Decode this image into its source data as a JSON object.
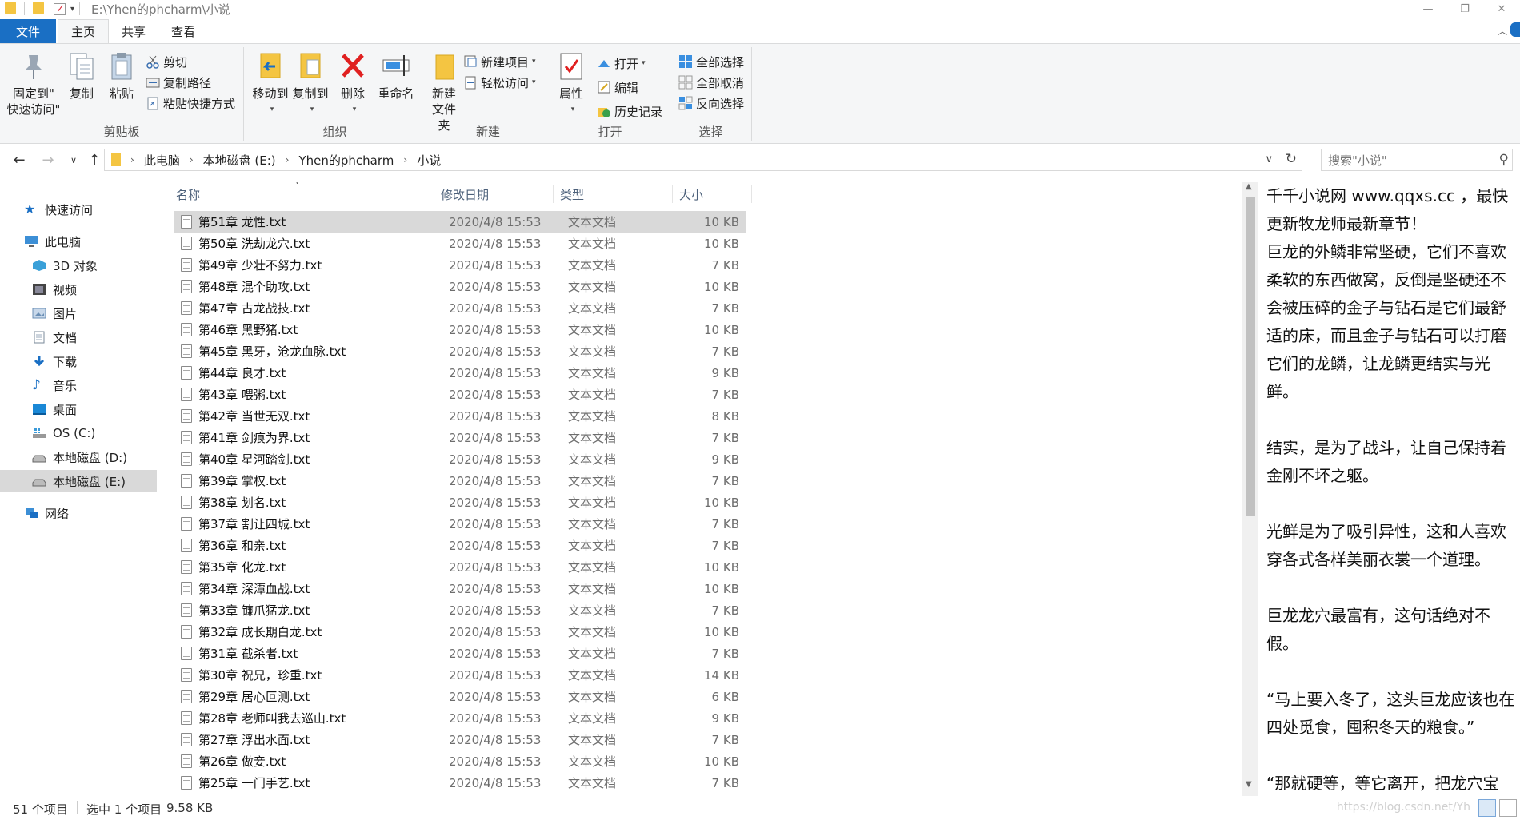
{
  "window": {
    "title": "E:\\Yhen的phcharm\\小说",
    "minimize": "—",
    "restore": "❐",
    "close": "✕"
  },
  "tabs": [
    {
      "label": "文件"
    },
    {
      "label": "主页"
    },
    {
      "label": "共享"
    },
    {
      "label": "查看"
    }
  ],
  "ribbon": {
    "clipboard": {
      "label": "剪贴板",
      "pin": "固定到\"\n快速访问\"",
      "pin1": "固定到\"",
      "pin2": "快速访问\"",
      "copy": "复制",
      "paste": "粘贴",
      "cut": "剪切",
      "copy_path": "复制路径",
      "paste_shortcut": "粘贴快捷方式"
    },
    "organize": {
      "label": "组织",
      "move_to": "移动到",
      "copy_to": "复制到",
      "delete": "删除",
      "rename": "重命名"
    },
    "new": {
      "label": "新建",
      "new_folder1": "新建",
      "new_folder2": "文件夹",
      "new_item": "新建项目",
      "easy_access": "轻松访问"
    },
    "open": {
      "label": "打开",
      "properties": "属性",
      "open": "打开",
      "edit": "编辑",
      "history": "历史记录"
    },
    "select": {
      "label": "选择",
      "select_all": "全部选择",
      "select_none": "全部取消",
      "invert": "反向选择"
    }
  },
  "address": {
    "crumbs": [
      "此电脑",
      "本地磁盘 (E:)",
      "Yhen的phcharm",
      "小说"
    ],
    "search_placeholder": "搜索\"小说\""
  },
  "nav": [
    {
      "label": "快速访问",
      "icon": "star-icon",
      "color": "#1a6fc4"
    },
    {
      "label": "此电脑",
      "icon": "computer-icon",
      "color": "#3c8fd6"
    },
    {
      "label": "3D 对象",
      "icon": "cube-icon",
      "color": "#3aa0d8"
    },
    {
      "label": "视频",
      "icon": "video-icon",
      "color": "#5b5b5b"
    },
    {
      "label": "图片",
      "icon": "picture-icon",
      "color": "#6b8fb5"
    },
    {
      "label": "文档",
      "icon": "document-icon",
      "color": "#7a8a9a"
    },
    {
      "label": "下载",
      "icon": "download-icon",
      "color": "#1a6fc4"
    },
    {
      "label": "音乐",
      "icon": "music-icon",
      "color": "#1a6fc4"
    },
    {
      "label": "桌面",
      "icon": "desktop-icon",
      "color": "#1a88d6"
    },
    {
      "label": "OS (C:)",
      "icon": "drive-os-icon",
      "color": "#3a9ad9"
    },
    {
      "label": "本地磁盘 (D:)",
      "icon": "drive-icon",
      "color": "#777"
    },
    {
      "label": "本地磁盘 (E:)",
      "icon": "drive-icon",
      "color": "#777"
    },
    {
      "label": "网络",
      "icon": "network-icon",
      "color": "#3c8fd6"
    }
  ],
  "columns": {
    "name": "名称",
    "date": "修改日期",
    "type": "类型",
    "size": "大小"
  },
  "files": [
    {
      "name": "第51章 龙性.txt",
      "date": "2020/4/8 15:53",
      "type": "文本文档",
      "size": "10 KB"
    },
    {
      "name": "第50章 洗劫龙穴.txt",
      "date": "2020/4/8 15:53",
      "type": "文本文档",
      "size": "10 KB"
    },
    {
      "name": "第49章 少壮不努力.txt",
      "date": "2020/4/8 15:53",
      "type": "文本文档",
      "size": "7 KB"
    },
    {
      "name": "第48章 混个助攻.txt",
      "date": "2020/4/8 15:53",
      "type": "文本文档",
      "size": "10 KB"
    },
    {
      "name": "第47章 古龙战技.txt",
      "date": "2020/4/8 15:53",
      "type": "文本文档",
      "size": "7 KB"
    },
    {
      "name": "第46章 黑野猪.txt",
      "date": "2020/4/8 15:53",
      "type": "文本文档",
      "size": "10 KB"
    },
    {
      "name": "第45章 黑牙，沧龙血脉.txt",
      "date": "2020/4/8 15:53",
      "type": "文本文档",
      "size": "7 KB"
    },
    {
      "name": "第44章 良才.txt",
      "date": "2020/4/8 15:53",
      "type": "文本文档",
      "size": "9 KB"
    },
    {
      "name": "第43章 喂粥.txt",
      "date": "2020/4/8 15:53",
      "type": "文本文档",
      "size": "7 KB"
    },
    {
      "name": "第42章 当世无双.txt",
      "date": "2020/4/8 15:53",
      "type": "文本文档",
      "size": "8 KB"
    },
    {
      "name": "第41章 剑痕为界.txt",
      "date": "2020/4/8 15:53",
      "type": "文本文档",
      "size": "7 KB"
    },
    {
      "name": "第40章 星河踏剑.txt",
      "date": "2020/4/8 15:53",
      "type": "文本文档",
      "size": "9 KB"
    },
    {
      "name": "第39章 掌权.txt",
      "date": "2020/4/8 15:53",
      "type": "文本文档",
      "size": "7 KB"
    },
    {
      "name": "第38章 划名.txt",
      "date": "2020/4/8 15:53",
      "type": "文本文档",
      "size": "10 KB"
    },
    {
      "name": "第37章 割让四城.txt",
      "date": "2020/4/8 15:53",
      "type": "文本文档",
      "size": "7 KB"
    },
    {
      "name": "第36章 和亲.txt",
      "date": "2020/4/8 15:53",
      "type": "文本文档",
      "size": "7 KB"
    },
    {
      "name": "第35章 化龙.txt",
      "date": "2020/4/8 15:53",
      "type": "文本文档",
      "size": "10 KB"
    },
    {
      "name": "第34章 深潭血战.txt",
      "date": "2020/4/8 15:53",
      "type": "文本文档",
      "size": "10 KB"
    },
    {
      "name": "第33章 镰爪猛龙.txt",
      "date": "2020/4/8 15:53",
      "type": "文本文档",
      "size": "7 KB"
    },
    {
      "name": "第32章 成长期白龙.txt",
      "date": "2020/4/8 15:53",
      "type": "文本文档",
      "size": "10 KB"
    },
    {
      "name": "第31章 截杀者.txt",
      "date": "2020/4/8 15:53",
      "type": "文本文档",
      "size": "7 KB"
    },
    {
      "name": "第30章 祝兄，珍重.txt",
      "date": "2020/4/8 15:53",
      "type": "文本文档",
      "size": "14 KB"
    },
    {
      "name": "第29章 居心叵测.txt",
      "date": "2020/4/8 15:53",
      "type": "文本文档",
      "size": "6 KB"
    },
    {
      "name": "第28章 老师叫我去巡山.txt",
      "date": "2020/4/8 15:53",
      "type": "文本文档",
      "size": "9 KB"
    },
    {
      "name": "第27章 浮出水面.txt",
      "date": "2020/4/8 15:53",
      "type": "文本文档",
      "size": "7 KB"
    },
    {
      "name": "第26章 做妾.txt",
      "date": "2020/4/8 15:53",
      "type": "文本文档",
      "size": "10 KB"
    },
    {
      "name": "第25章 一门手艺.txt",
      "date": "2020/4/8 15:53",
      "type": "文本文档",
      "size": "7 KB"
    }
  ],
  "preview": {
    "paragraphs": [
      "千千小说网 www.qqxs.cc ，最快更新牧龙师最新章节！\n巨龙的外鳞非常坚硬，它们不喜欢柔软的东西做窝，反倒是坚硬还不会被压碎的金子与钻石是它们最舒适的床，而且金子与钻石可以打磨它们的龙鳞，让龙鳞更结实与光鲜。",
      "结实，是为了战斗，让自己保持着金刚不坏之躯。",
      "光鲜是为了吸引异性，这和人喜欢穿各式各样美丽衣裳一个道理。",
      "巨龙龙穴最富有，这句话绝对不假。",
      "“马上要入冬了，这头巨龙应该也在四处觅食，囤积冬天的粮食。”",
      "“那就硬等，等它离开，把龙穴宝"
    ]
  },
  "status": {
    "count": "51 个项目",
    "selected": "选中 1 个项目",
    "size": "9.58 KB",
    "watermark": "https://blog.csdn.net/Yh"
  }
}
